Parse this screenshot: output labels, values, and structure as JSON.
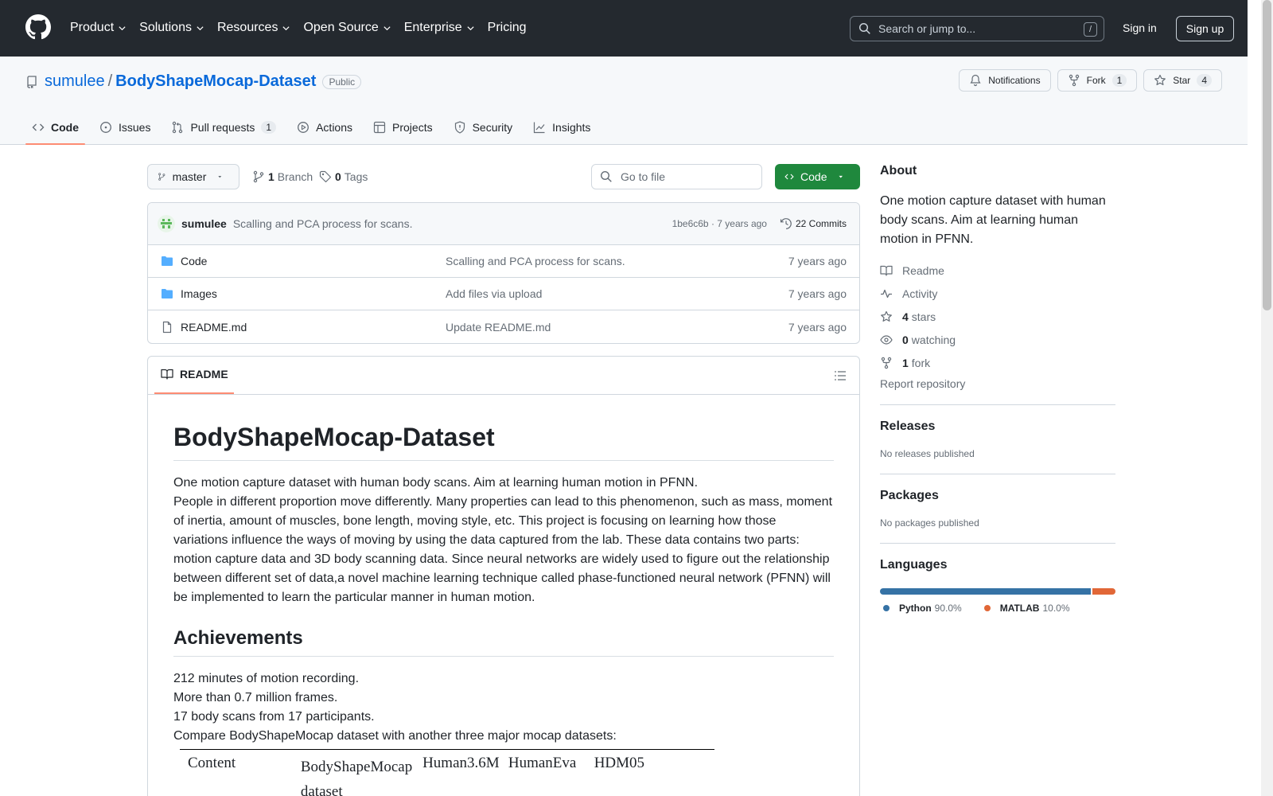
{
  "header": {
    "nav": [
      "Product",
      "Solutions",
      "Resources",
      "Open Source",
      "Enterprise",
      "Pricing"
    ],
    "search_placeholder": "Search or jump to...",
    "search_key": "/",
    "signin": "Sign in",
    "signup": "Sign up"
  },
  "repo": {
    "owner": "sumulee",
    "separator": "/",
    "name": "BodyShapeMocap-Dataset",
    "visibility": "Public",
    "notifications": "Notifications",
    "fork_label": "Fork",
    "fork_count": "1",
    "star_label": "Star",
    "star_count": "4",
    "tabs": [
      {
        "label": "Code",
        "icon": "code-icon"
      },
      {
        "label": "Issues",
        "icon": "issue-opened-icon"
      },
      {
        "label": "Pull requests",
        "icon": "git-pull-request-icon",
        "count": "1"
      },
      {
        "label": "Actions",
        "icon": "play-icon"
      },
      {
        "label": "Projects",
        "icon": "table-icon"
      },
      {
        "label": "Security",
        "icon": "shield-icon"
      },
      {
        "label": "Insights",
        "icon": "graph-icon"
      }
    ]
  },
  "filenav": {
    "branch": "master",
    "branch_count": "1",
    "branch_label": "Branch",
    "tag_count": "0",
    "tag_label": "Tags",
    "goto_placeholder": "Go to file",
    "code_button": "Code"
  },
  "commit": {
    "author": "sumulee",
    "message": "Scalling and PCA process for scans.",
    "hash_time": "1be6c6b · 7 years ago",
    "commits": "22 Commits"
  },
  "files": [
    {
      "name": "Code",
      "type": "folder",
      "message": "Scalling and PCA process for scans.",
      "age": "7 years ago"
    },
    {
      "name": "Images",
      "type": "folder",
      "message": "Add files via upload",
      "age": "7 years ago"
    },
    {
      "name": "README.md",
      "type": "file",
      "message": "Update README.md",
      "age": "7 years ago"
    }
  ],
  "readme": {
    "tab": "README",
    "title": "BodyShapeMocap-Dataset",
    "intro1": "One motion capture dataset with human body scans. Aim at learning human motion in PFNN.",
    "intro2": "People in different proportion move differently. Many properties can lead to this phenomenon, such as mass, moment of inertia, amount of muscles, bone length, moving style, etc. This project is focusing on learning how those variations influence the ways of moving by using the data captured from the lab. These data contains two parts: motion capture data and 3D body scanning data. Since neural networks are widely used to figure out the relationship between different set of data,a novel machine learning technique called phase-functioned neural network (PFNN) will be implemented to learn the particular manner in human motion.",
    "h2": "Achievements",
    "lines": [
      "212 minutes of motion recording.",
      "More than 0.7 million frames.",
      "17 body scans from 17 participants.",
      "Compare BodyShapeMocap dataset with another three major mocap datasets:"
    ],
    "table_headers": [
      "Content",
      "BodyShapeMocap dataset",
      "Human3.6M",
      "HumanEva",
      "HDM05"
    ]
  },
  "sidebar": {
    "about_title": "About",
    "about_desc": "One motion capture dataset with human body scans. Aim at learning human motion in PFNN.",
    "readme": "Readme",
    "activity": "Activity",
    "stars_count": "4",
    "stars": "stars",
    "watching_count": "0",
    "watching": "watching",
    "forks_count": "1",
    "forks": "fork",
    "report": "Report repository",
    "releases_title": "Releases",
    "releases_text": "No releases published",
    "packages_title": "Packages",
    "packages_text": "No packages published",
    "languages_title": "Languages",
    "languages": [
      {
        "name": "Python",
        "pct": "90.0%",
        "value": 90.0,
        "color": "#3572A5"
      },
      {
        "name": "MATLAB",
        "pct": "10.0%",
        "value": 10.0,
        "color": "#e16737"
      }
    ]
  }
}
